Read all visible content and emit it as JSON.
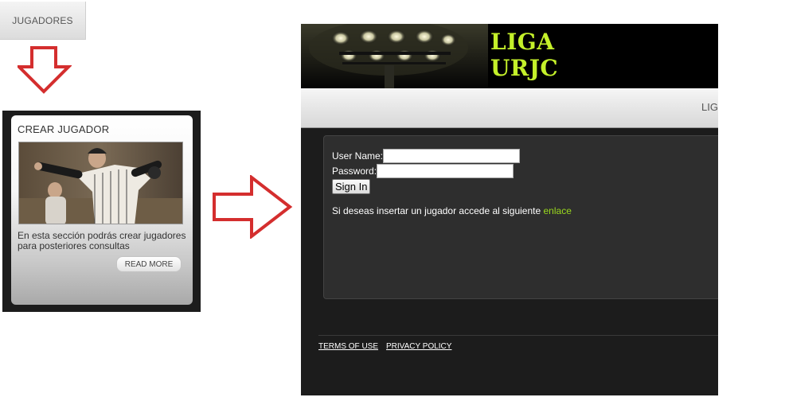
{
  "tab": {
    "label": "JUGADORES"
  },
  "card": {
    "title": "CREAR JUGADOR",
    "description": "En esta sección podrás crear jugadores para posteriores consultas",
    "read_more_label": "READ MORE"
  },
  "site": {
    "banner_title": "LIGA URJC",
    "nav_item": "LIG",
    "login": {
      "username_label": "User Name:",
      "username_value": "",
      "password_label": "Password:",
      "password_value": "",
      "signin_label": "Sign In"
    },
    "info_text": "Si deseas insertar un jugador accede al siguiente ",
    "info_link": "enlace",
    "footer": {
      "terms": "TERMS OF USE",
      "privacy": "PRIVACY POLICY"
    }
  },
  "colors": {
    "arrow": "#d42e2e",
    "logo_text": "#c4f02a",
    "link": "#9ad81e"
  },
  "icons": [
    "down-arrow-icon",
    "right-arrow-icon",
    "stadium-lights-icon"
  ]
}
